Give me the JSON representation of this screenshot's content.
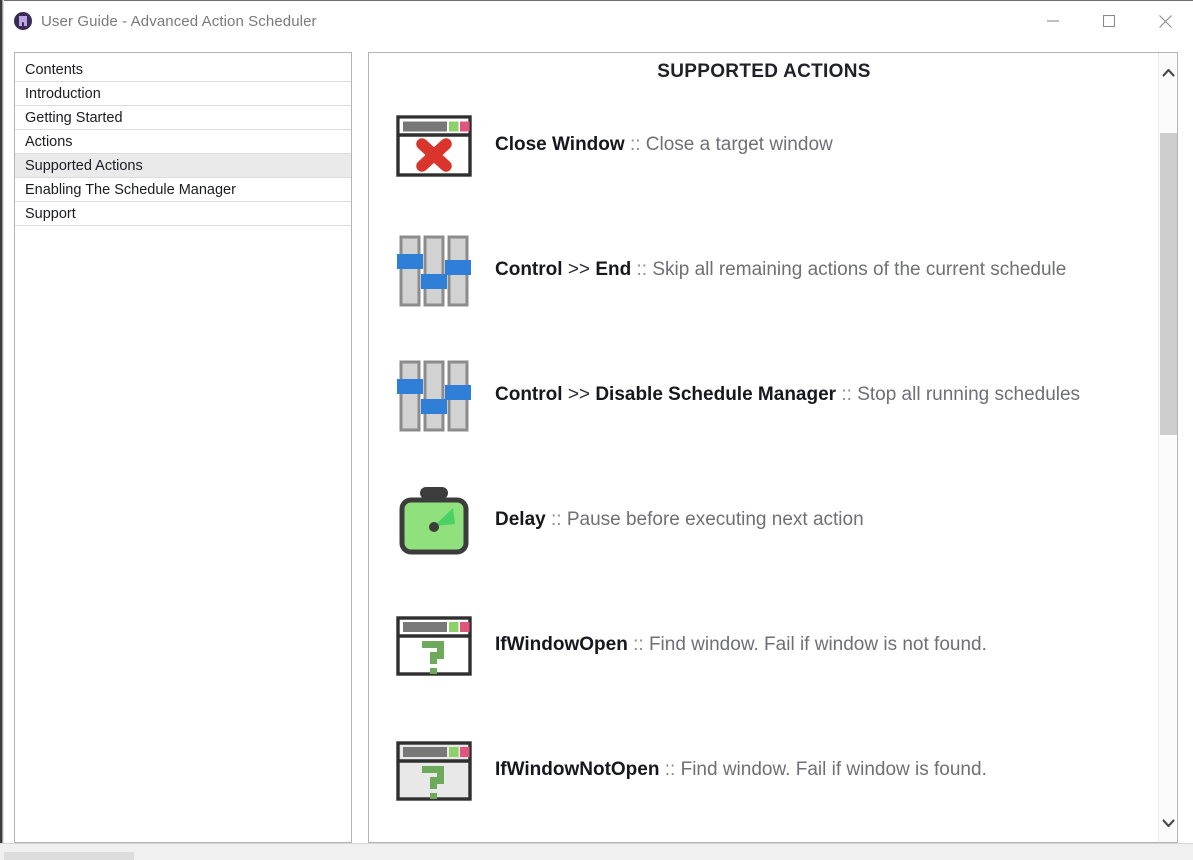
{
  "window": {
    "title": "User Guide - Advanced Action Scheduler",
    "app_icon": "app-logo-icon",
    "controls": {
      "minimize": "minimize-icon",
      "maximize": "maximize-icon",
      "close": "close-icon"
    }
  },
  "sidebar": {
    "items": [
      {
        "label": "Contents",
        "selected": false
      },
      {
        "label": "Introduction",
        "selected": false
      },
      {
        "label": "Getting Started",
        "selected": false
      },
      {
        "label": "Actions",
        "selected": false
      },
      {
        "label": "Supported Actions",
        "selected": true
      },
      {
        "label": "Enabling The Schedule Manager",
        "selected": false
      },
      {
        "label": "Support",
        "selected": false
      }
    ]
  },
  "content": {
    "heading": "SUPPORTED ACTIONS",
    "actions": [
      {
        "icon": "window-close-icon",
        "name": "Close Window",
        "arrow": "",
        "sub": "",
        "separator": "::",
        "description": "Close a target window"
      },
      {
        "icon": "sliders-icon",
        "name": "Control",
        "arrow": ">>",
        "sub": "End",
        "separator": "::",
        "description": "Skip all remaining actions of the current schedule"
      },
      {
        "icon": "sliders-icon",
        "name": "Control",
        "arrow": ">>",
        "sub": "Disable Schedule Manager",
        "separator": "::",
        "description": "Stop all running schedules"
      },
      {
        "icon": "timer-icon",
        "name": "Delay",
        "arrow": "",
        "sub": "",
        "separator": "::",
        "description": "Pause before executing next action"
      },
      {
        "icon": "window-question-icon",
        "name": "IfWindowOpen",
        "arrow": "",
        "sub": "",
        "separator": "::",
        "description": "Find window. Fail if window is not found."
      },
      {
        "icon": "window-question-icon",
        "name": "IfWindowNotOpen",
        "arrow": "",
        "sub": "",
        "separator": "::",
        "description": "Find window. Fail if window is found."
      }
    ]
  },
  "scrollbar": {
    "up_arrow": "chevron-up-icon",
    "down_arrow": "chevron-down-icon"
  },
  "colors": {
    "accent_blue": "#2f7fd8",
    "icon_green": "#6fa95c",
    "icon_red": "#d9352c",
    "selection_gray": "#eaeaea",
    "title_text": "#7a7a7a"
  }
}
